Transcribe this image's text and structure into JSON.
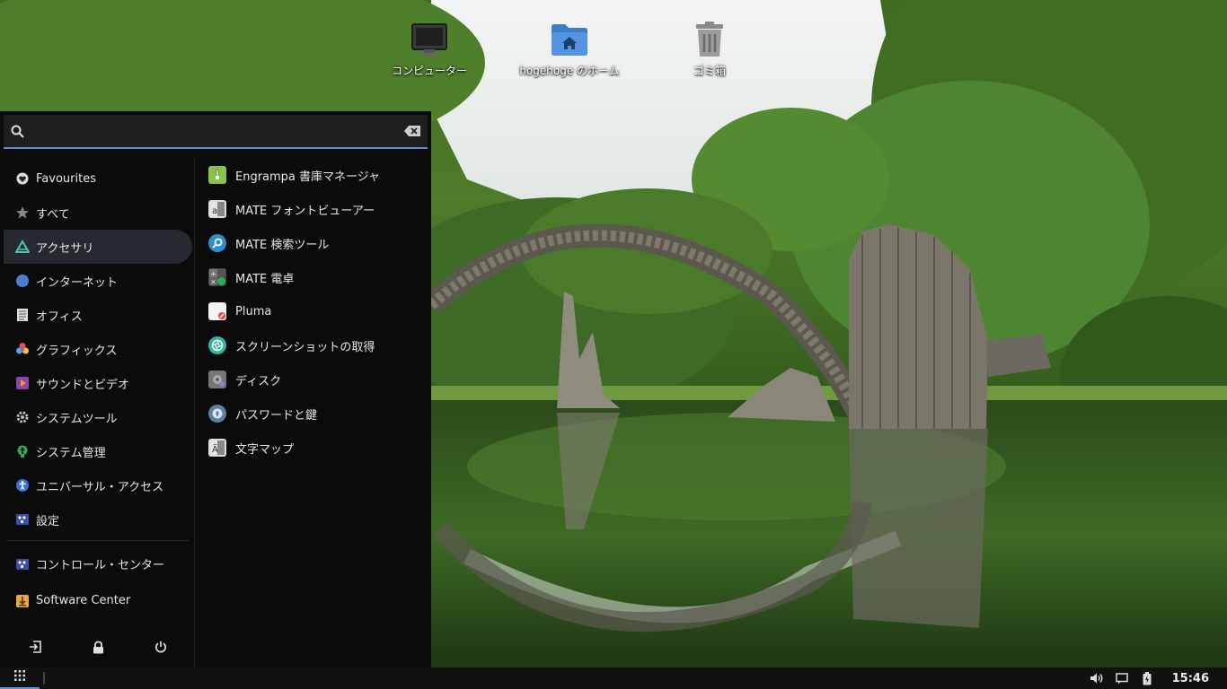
{
  "desktop": {
    "icons": [
      {
        "label": "コンピューター",
        "icon": "computer-icon"
      },
      {
        "label": "hogehoge のホーム",
        "icon": "home-folder-icon"
      },
      {
        "label": "ゴミ箱",
        "icon": "trash-icon"
      }
    ]
  },
  "menu": {
    "search": {
      "value": "",
      "placeholder": ""
    },
    "categories": [
      {
        "label": "Favourites",
        "icon": "heart-icon"
      },
      {
        "label": "すべて",
        "icon": "star-icon"
      },
      {
        "label": "アクセサリ",
        "icon": "accessories-icon",
        "active": true
      },
      {
        "label": "インターネット",
        "icon": "internet-icon"
      },
      {
        "label": "オフィス",
        "icon": "office-icon"
      },
      {
        "label": "グラフィックス",
        "icon": "graphics-icon"
      },
      {
        "label": "サウンドとビデオ",
        "icon": "multimedia-icon"
      },
      {
        "label": "システムツール",
        "icon": "system-tools-icon"
      },
      {
        "label": "システム管理",
        "icon": "administration-icon"
      },
      {
        "label": "ユニバーサル・アクセス",
        "icon": "accessibility-icon"
      },
      {
        "label": "設定",
        "icon": "settings-icon"
      }
    ],
    "extra": [
      {
        "label": "コントロール・センター",
        "icon": "control-center-icon"
      },
      {
        "label": "Software Center",
        "icon": "software-center-icon"
      }
    ],
    "apps": [
      {
        "label": "Engrampa 書庫マネージャ",
        "icon": "archive-manager-icon"
      },
      {
        "label": "MATE フォントビューアー",
        "icon": "font-viewer-icon"
      },
      {
        "label": "MATE 検索ツール",
        "icon": "search-tool-icon"
      },
      {
        "label": "MATE 電卓",
        "icon": "calculator-icon"
      },
      {
        "label": "Pluma",
        "icon": "text-editor-icon"
      },
      {
        "label": "スクリーンショットの取得",
        "icon": "screenshot-icon"
      },
      {
        "label": "ディスク",
        "icon": "disks-icon"
      },
      {
        "label": "パスワードと鍵",
        "icon": "passwords-keys-icon"
      },
      {
        "label": "文字マップ",
        "icon": "character-map-icon"
      }
    ],
    "actions": [
      "logout-icon",
      "lock-icon",
      "power-icon"
    ]
  },
  "panel": {
    "clock": "15:46",
    "tray": [
      "volume-icon",
      "notification-icon",
      "battery-icon"
    ]
  },
  "colors": {
    "accent": "#5b8dd9",
    "menu_bg": "#0b0b0b",
    "active_bg": "#262a30"
  }
}
